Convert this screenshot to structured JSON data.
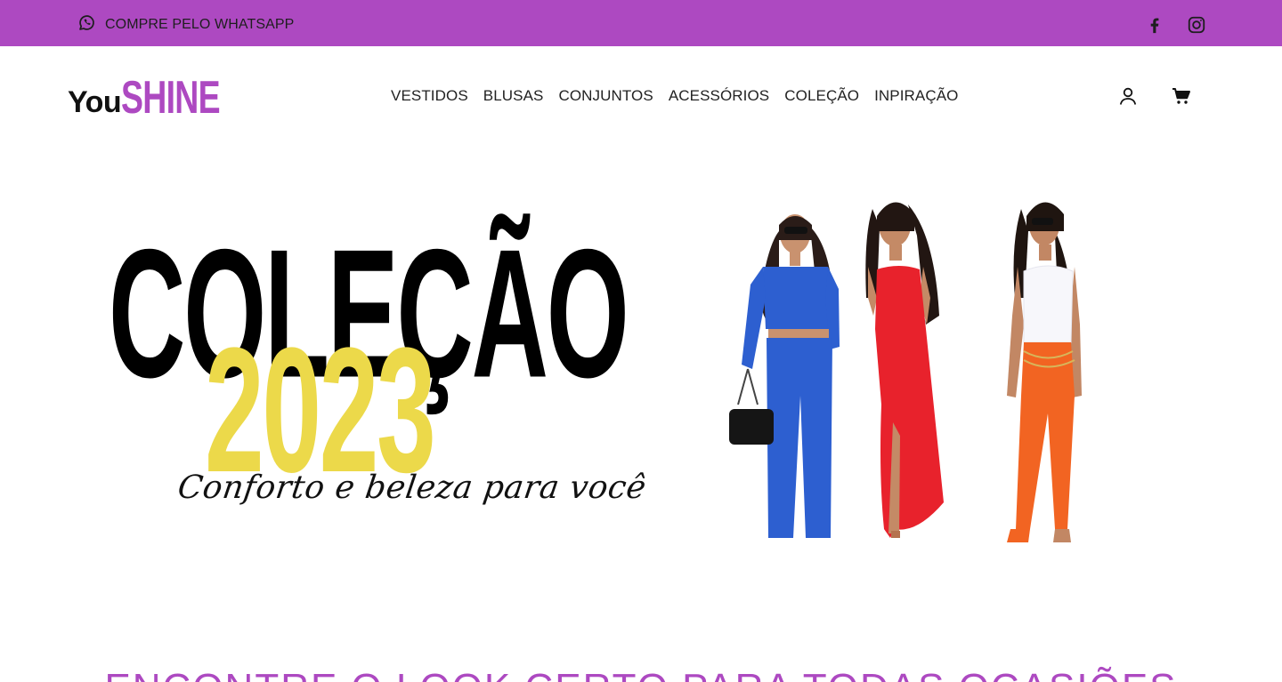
{
  "topbar": {
    "whatsapp_label": "COMPRE PELO WHATSAPP",
    "background": "#ad49c1",
    "icons": [
      "whatsapp-icon",
      "facebook-icon",
      "instagram-icon"
    ]
  },
  "header": {
    "logo_you": "You",
    "logo_shine": "SHINE",
    "logo_accent": "#ad49c1",
    "nav": [
      "VESTIDOS",
      "BLUSAS",
      "CONJUNTOS",
      "ACESSÓRIOS",
      "COLEÇÃO",
      "INPIRAÇÃO"
    ],
    "icons": [
      "user-icon",
      "cart-icon"
    ]
  },
  "hero": {
    "title": "COLEÇÃO",
    "year": "2023",
    "tagline": "Conforto e beleza para você",
    "year_color": "#ecd94a",
    "models": [
      {
        "outfit": "blue-set",
        "color": "#2d5fd0"
      },
      {
        "outfit": "red-dress",
        "color": "#e8222c"
      },
      {
        "outfit": "orange-pants",
        "color": "#f26422"
      }
    ]
  },
  "section": {
    "heading": "ENCONTRE O LOOK CERTO PARA TODAS OCASIÕES"
  }
}
